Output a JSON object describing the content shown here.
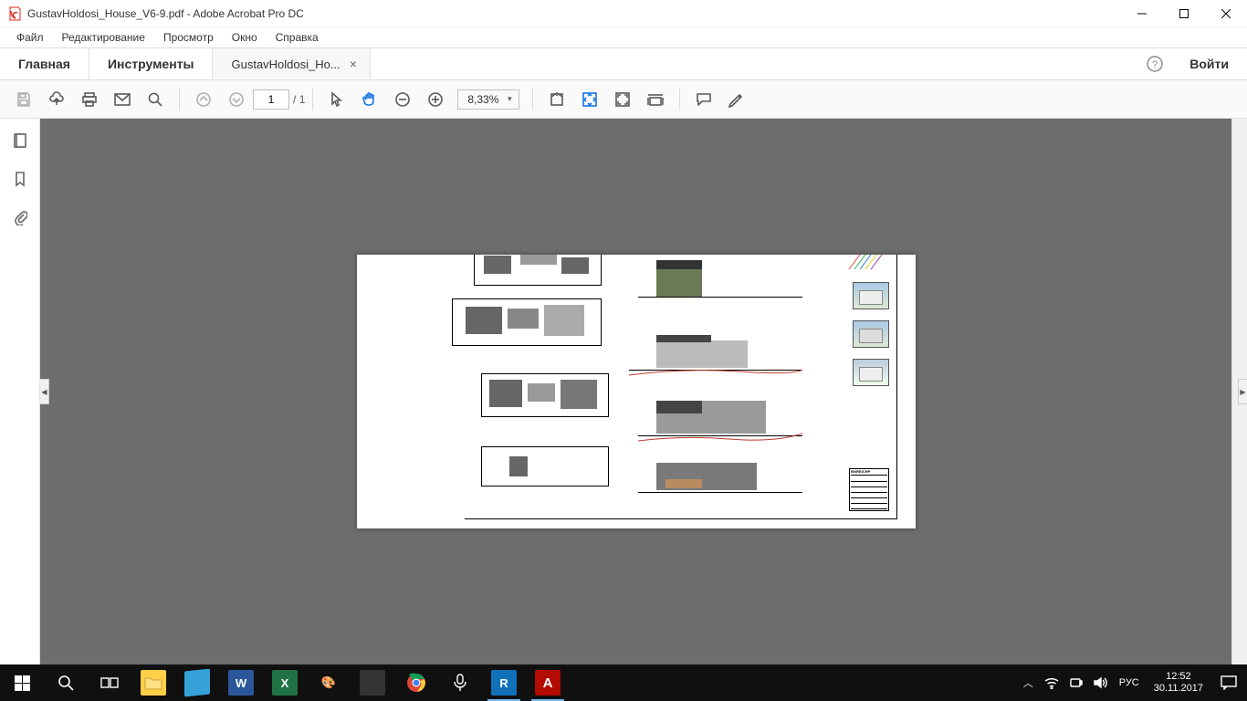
{
  "titlebar": {
    "title": "GustavHoldosi_House_V6-9.pdf - Adobe Acrobat Pro DC"
  },
  "menubar": {
    "file": "Файл",
    "edit": "Редактирование",
    "view": "Просмотр",
    "window": "Окно",
    "help": "Справка"
  },
  "tabbar": {
    "home": "Главная",
    "tools": "Инструменты",
    "doc": "GustavHoldosi_Ho...",
    "login": "Войти"
  },
  "toolbar": {
    "page_current": "1",
    "page_sep": "/",
    "page_total": "1",
    "zoom": "8,33%"
  },
  "document": {
    "titleblock_header": "EINREICHP"
  },
  "taskbar": {
    "lang": "РУС",
    "time": "12:52",
    "date": "30.11.2017"
  }
}
